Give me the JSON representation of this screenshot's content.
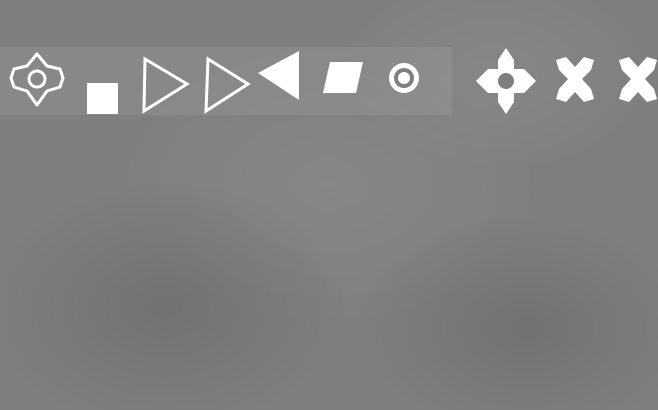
{
  "colors": {
    "background": "#7f7f7f",
    "symbol": "#ffffff",
    "strip": "rgba(255,255,255,0.07)"
  },
  "symbols": [
    {
      "icon": "ornate-diamond-ring-icon",
      "style": "outline"
    },
    {
      "icon": "square-icon",
      "style": "filled"
    },
    {
      "icon": "triangle-right-icon",
      "style": "outline"
    },
    {
      "icon": "triangle-right-icon",
      "style": "outline"
    },
    {
      "icon": "triangle-left-icon",
      "style": "filled"
    },
    {
      "icon": "parallelogram-icon",
      "style": "filled"
    },
    {
      "icon": "target-ring-icon",
      "style": "filled"
    },
    {
      "icon": "four-petal-ring-icon",
      "style": "filled"
    },
    {
      "icon": "cross-x-icon",
      "style": "filled"
    },
    {
      "icon": "cross-x-icon",
      "style": "filled"
    }
  ]
}
